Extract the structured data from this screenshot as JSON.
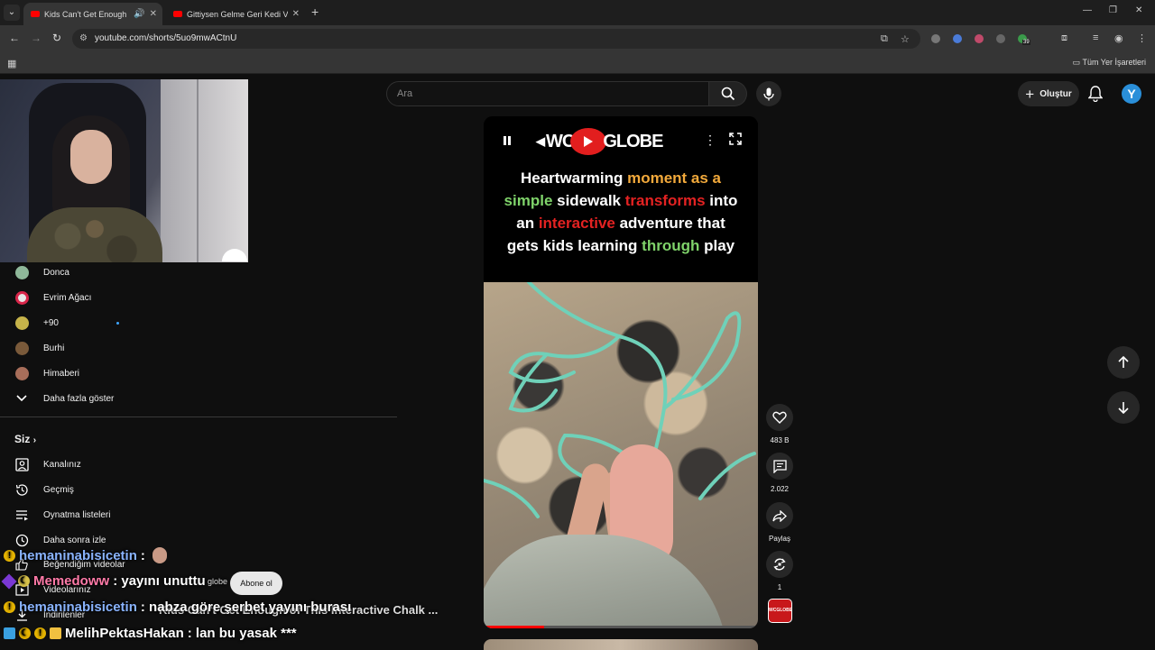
{
  "browser": {
    "tabs": [
      {
        "title": "Kids Can't Get Enough of Th",
        "active": true
      },
      {
        "title": "Gittiysen Gelme Geri Kedi Versi",
        "active": false
      }
    ],
    "url": "youtube.com/shorts/5uo9mwACtnU",
    "bookmarks_all": "Tüm Yer İşaretleri",
    "extension_badge": "39"
  },
  "header": {
    "search_placeholder": "Ara",
    "create_label": "Oluştur",
    "avatar_letter": "Y"
  },
  "sidebar": {
    "channels": [
      {
        "label": "Donca",
        "color": "#8fb89a"
      },
      {
        "label": "Evrim Ağacı",
        "color": "#e8e8e8"
      },
      {
        "label": "+90",
        "color": "#c6b34a"
      },
      {
        "label": "Burhi",
        "color": "#7a5a3a"
      },
      {
        "label": "Himaberi",
        "color": "#a86e5a"
      }
    ],
    "show_more": "Daha fazla göster",
    "you_section": "Siz",
    "you_items": [
      {
        "label": "Kanalınız",
        "icon": "channel-icon"
      },
      {
        "label": "Geçmiş",
        "icon": "history-icon"
      },
      {
        "label": "Oynatma listeleri",
        "icon": "playlist-icon"
      },
      {
        "label": "Daha sonra izle",
        "icon": "watch-later-icon"
      },
      {
        "label": "Beğendiğim videolar",
        "icon": "like-icon"
      },
      {
        "label": "Videolarınız",
        "icon": "your-videos-icon"
      },
      {
        "label": "İndirilenler",
        "icon": "download-icon"
      }
    ]
  },
  "short": {
    "logo_left": "WC",
    "logo_right": "GLOBE",
    "caption_parts": [
      {
        "text": "Heartwarming ",
        "color": "white"
      },
      {
        "text": "moment as a",
        "color": "orange"
      },
      {
        "text": "simple",
        "color": "green"
      },
      {
        "text": " sidewalk ",
        "color": "white"
      },
      {
        "text": "transforms",
        "color": "red"
      },
      {
        "text": " into",
        "color": "white"
      },
      {
        "text": "an ",
        "color": "white"
      },
      {
        "text": "interactive",
        "color": "red"
      },
      {
        "text": " adventure that",
        "color": "white"
      },
      {
        "text": "gets kids learning ",
        "color": "white"
      },
      {
        "text": "through",
        "color": "green"
      },
      {
        "text": " play",
        "color": "white"
      }
    ],
    "progress": 0.22,
    "channel_thumb": "WCGLOBE",
    "title_partial": "Kids Can't Get Enough of This Interactive Chalk ...",
    "channel_partial": "globe",
    "subscribe_label": "Abone ol"
  },
  "actions": {
    "likes": "483 B",
    "comments": "2.022",
    "share": "Paylaş",
    "remix": "1"
  },
  "chat": [
    {
      "user": "hemaninabisicetin",
      "message": ":",
      "user_color": "#8ab4ff"
    },
    {
      "user": "Memedoww",
      "message": ": yayını unuttu",
      "user_color": "#ff7aa8"
    },
    {
      "user": "hemaninabisicetin",
      "message": ": nabza göre şerbet yayını burası",
      "user_color": "#8ab4ff"
    },
    {
      "user": "MelihPektasHakan",
      "message": ": lan bu yasak ***",
      "user_color": "#ffffff"
    }
  ]
}
